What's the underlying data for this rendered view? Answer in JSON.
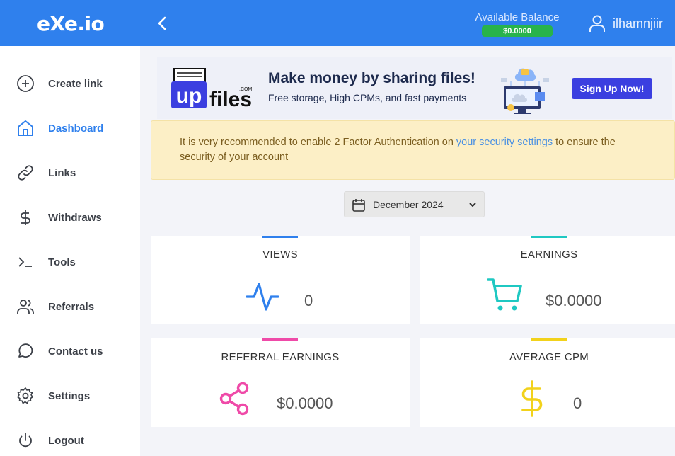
{
  "header": {
    "logo_text": "eXe.io",
    "balance_label": "Available Balance",
    "balance_value": "$0.0000",
    "username": "ilhamnjiir",
    "accent": "#2f80ed"
  },
  "sidebar": {
    "items": [
      {
        "label": "Create link",
        "icon": "plus-circle-icon"
      },
      {
        "label": "Dashboard",
        "icon": "home-icon",
        "active": true
      },
      {
        "label": "Links",
        "icon": "link-icon"
      },
      {
        "label": "Withdraws",
        "icon": "dollar-icon"
      },
      {
        "label": "Tools",
        "icon": "terminal-icon"
      },
      {
        "label": "Referrals",
        "icon": "users-icon"
      },
      {
        "label": "Contact us",
        "icon": "chat-icon"
      },
      {
        "label": "Settings",
        "icon": "gear-icon"
      },
      {
        "label": "Logout",
        "icon": "power-icon"
      }
    ]
  },
  "banner": {
    "logo_up": "up",
    "logo_files": "files",
    "logo_com": ".COM",
    "title": "Make money by sharing files!",
    "subtitle": "Free storage, High CPMs, and fast payments",
    "button": "Sign Up Now!"
  },
  "alert": {
    "text_before": "It is very recommended to enable 2 Factor Authentication on ",
    "link": "your security settings",
    "text_after": " to ensure the security of your account"
  },
  "month_select": {
    "value": "December 2024"
  },
  "stats": {
    "views": {
      "title": "VIEWS",
      "value": "0",
      "color": "#2f80ed"
    },
    "earnings": {
      "title": "EARNINGS",
      "value": "$0.0000",
      "color": "#1fc8c2"
    },
    "referral_earnings": {
      "title": "REFERRAL EARNINGS",
      "value": "$0.0000",
      "color": "#ef4aa8"
    },
    "average_cpm": {
      "title": "AVERAGE CPM",
      "value": "0",
      "color": "#f2d21b"
    }
  }
}
